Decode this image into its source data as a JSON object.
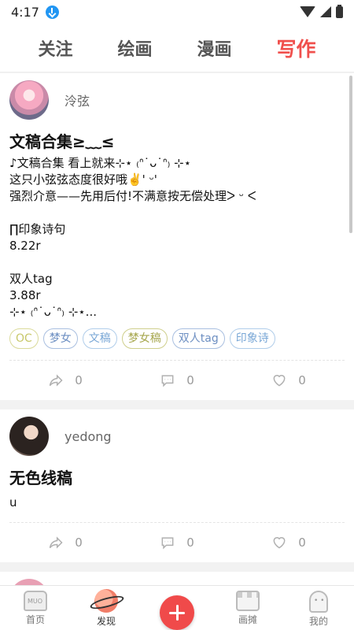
{
  "status_bar": {
    "time": "4:17"
  },
  "tabs": [
    {
      "label": "关注",
      "active": false
    },
    {
      "label": "绘画",
      "active": false
    },
    {
      "label": "漫画",
      "active": false
    },
    {
      "label": "写作",
      "active": true
    }
  ],
  "posts": [
    {
      "author": "泠弦",
      "title": "文稿合集≥﹏≤",
      "body": "♪文稿合集 看上就来⊹⋆ ₍ᐢ˙ᴗ˙ᐢ₎ ⊹⋆\n这只小弦弦态度很好哦✌️' ᵕ'\n强烈介意——先用后付!不满意按无偿处理ᐳ ᵕ ᐸ\n\n∏印象诗句\n8.22r\n\n双人tag\n3.88r\n⊹⋆ ₍ᐢ˙ᴗ˙ᐢ₎ ⊹⋆...",
      "tags": [
        "OC",
        "梦女",
        "文稿",
        "梦女稿",
        "双人tag",
        "印象诗"
      ],
      "shares": "0",
      "comments": "0",
      "likes": "0"
    },
    {
      "author": "yedong",
      "title": "无色线稿",
      "body": "u",
      "tags": [],
      "shares": "0",
      "comments": "0",
      "likes": "0"
    }
  ],
  "bottom_nav": [
    {
      "label": "首页",
      "icon": "home-icon"
    },
    {
      "label": "发现",
      "icon": "planet-icon",
      "active": true
    },
    {
      "label": "",
      "icon": "add-icon"
    },
    {
      "label": "画摊",
      "icon": "stall-icon"
    },
    {
      "label": "我的",
      "icon": "profile-icon"
    }
  ],
  "colors": {
    "accent": "#f0504d",
    "add_button": "#f04a4a"
  }
}
